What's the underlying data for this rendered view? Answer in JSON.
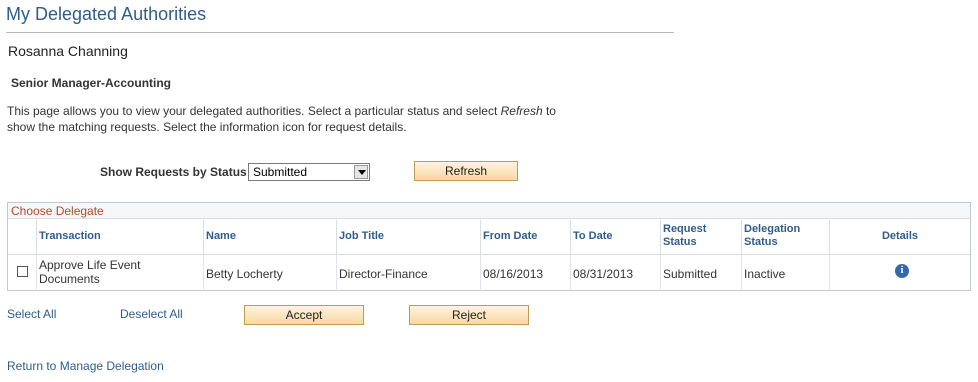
{
  "page": {
    "title": "My Delegated Authorities",
    "person_name": "Rosanna Channing",
    "job_title": "Senior Manager-Accounting",
    "instructions_1": "This page allows you to view your delegated authorities. Select a particular status and select ",
    "instructions_emph": "Refresh",
    "instructions_2": " to show the matching requests. Select the information icon for request details."
  },
  "filter": {
    "label": "Show Requests by Status",
    "selected": "Submitted",
    "refresh_label": "Refresh"
  },
  "grid": {
    "title": "Choose Delegate",
    "columns": {
      "transaction": "Transaction",
      "name": "Name",
      "job_title": "Job Title",
      "from_date": "From Date",
      "to_date": "To Date",
      "request_status_1": "Request",
      "request_status_2": "Status",
      "delegation_status_1": "Delegation",
      "delegation_status_2": "Status",
      "details": "Details"
    },
    "rows": [
      {
        "transaction": "Approve Life Event Documents",
        "name": "Betty Locherty",
        "job_title": "Director-Finance",
        "from_date": "08/16/2013",
        "to_date": "08/31/2013",
        "request_status": "Submitted",
        "delegation_status": "Inactive",
        "details_icon": "info-icon"
      }
    ]
  },
  "actions": {
    "select_all": "Select All",
    "deselect_all": "Deselect All",
    "accept": "Accept",
    "reject": "Reject",
    "return_link": "Return to Manage Delegation"
  }
}
